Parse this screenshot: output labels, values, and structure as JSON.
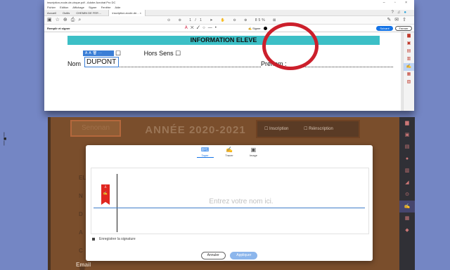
{
  "top_window": {
    "title": "inscription-ecole-de-cirque.pdf - Adobe Acrobat Pro DC",
    "menu": [
      "Fichier",
      "Edition",
      "Affichage",
      "Signer",
      "Fenêtre",
      "Aide"
    ],
    "tabs": [
      "Accueil",
      "Outils",
      "CHEMIN DE FER ...",
      "inscription-ecole-de... ×"
    ],
    "page_indicator": "1 / 1",
    "zoom": "85%",
    "fill_sign_label": "Remplir et signer",
    "sign_tool_label": "Signer",
    "send_button": "Suivant",
    "close_button": "Fermer",
    "form": {
      "band_title": "INFORMATION ELEVE",
      "sens_label": "Sens ☐",
      "hors_sens_label": "Hors Sens ☐",
      "nom_label": "Nom",
      "prenom_label": "Prénom :",
      "entered_name": "DUPONT"
    }
  },
  "bottom_window": {
    "header_left": "Senonan",
    "year_title": "ANNÉE 2020-2021",
    "checkbox_inscription": "☐ Inscription",
    "checkbox_reinscription": "☐ Réinscription",
    "email_label": "Email",
    "dialog": {
      "modes": [
        {
          "label": "Taper",
          "icon": "⌨"
        },
        {
          "label": "Tracer",
          "icon": "✍"
        },
        {
          "label": "Image",
          "icon": "▣"
        }
      ],
      "placeholder": "Entrez votre nom ici.",
      "save_signature": "Enregistrer la signature",
      "cancel": "Annuler",
      "apply": "Appliquer"
    }
  },
  "colors": {
    "accent_blue": "#1473e6",
    "band_teal": "#3cbfc6",
    "highlight_red": "#cc1f2b",
    "acrobat_red": "#e02620"
  }
}
